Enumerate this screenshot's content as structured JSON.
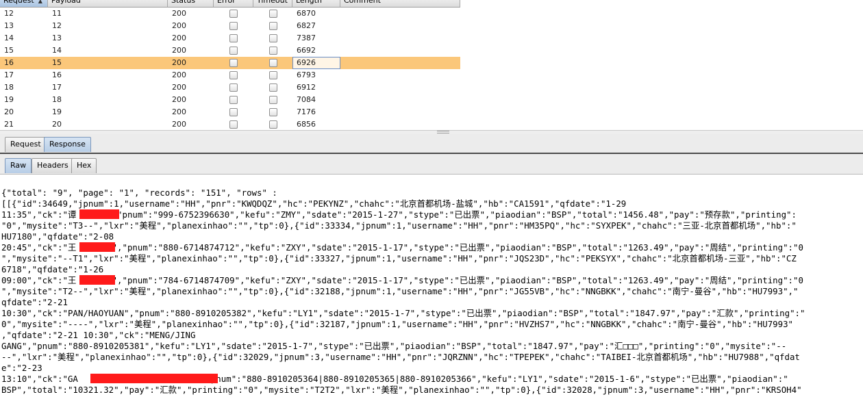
{
  "table": {
    "columns": [
      "Request",
      "Payload",
      "Status",
      "Error",
      "Timeout",
      "Length",
      "Comment"
    ],
    "sorted_column": "Request",
    "rows": [
      {
        "request": "12",
        "payload": "11",
        "status": "200",
        "length": "6870",
        "selected": false
      },
      {
        "request": "13",
        "payload": "12",
        "status": "200",
        "length": "6827",
        "selected": false
      },
      {
        "request": "14",
        "payload": "13",
        "status": "200",
        "length": "7387",
        "selected": false
      },
      {
        "request": "15",
        "payload": "14",
        "status": "200",
        "length": "6692",
        "selected": false
      },
      {
        "request": "16",
        "payload": "15",
        "status": "200",
        "length": "6926",
        "selected": true
      },
      {
        "request": "17",
        "payload": "16",
        "status": "200",
        "length": "6793",
        "selected": false
      },
      {
        "request": "18",
        "payload": "17",
        "status": "200",
        "length": "6912",
        "selected": false
      },
      {
        "request": "19",
        "payload": "18",
        "status": "200",
        "length": "7084",
        "selected": false
      },
      {
        "request": "20",
        "payload": "19",
        "status": "200",
        "length": "7176",
        "selected": false
      },
      {
        "request": "21",
        "payload": "20",
        "status": "200",
        "length": "6856",
        "selected": false
      }
    ]
  },
  "req_resp_tabs": [
    {
      "label": "Request",
      "active": false
    },
    {
      "label": "Response",
      "active": true
    }
  ],
  "view_tabs": [
    {
      "label": "Raw",
      "active": true
    },
    {
      "label": "Headers",
      "active": false
    },
    {
      "label": "Hex",
      "active": false
    }
  ],
  "raw_lines": [
    "{\"total\": \"9\", \"page\": \"1\", \"records\": \"151\", \"rows\" :",
    "[[{\"id\":34649,\"jpnum\":1,\"username\":\"HH\",\"pnr\":\"KWQDQZ\",\"hc\":\"PEKYNZ\",\"chahc\":\"北京首都机场-盐城\",\"hb\":\"CA1591\",\"qfdate\":\"1-29",
    "11:35\",\"ck\":\"谭      \",\"pnum\":\"999-6752396630\",\"kefu\":\"ZMY\",\"sdate\":\"2015-1-27\",\"stype\":\"已出票\",\"piaodian\":\"BSP\",\"total\":\"1456.48\",\"pay\":\"预存款\",\"printing\":",
    "\"0\",\"mysite\":\"T3--\",\"lxr\":\"美程\",\"planexinhao\":\"\",\"tp\":0},{\"id\":33334,\"jpnum\":1,\"username\":\"HH\",\"pnr\":\"HM35PQ\",\"hc\":\"SYXPEK\",\"chahc\":\"三亚-北京首都机场\",\"hb\":\"",
    "HU7180\",\"qfdate\":\"2-08",
    "20:45\",\"ck\":\"王      D\",\"pnum\":\"880-6714874712\",\"kefu\":\"ZXY\",\"sdate\":\"2015-1-17\",\"stype\":\"已出票\",\"piaodian\":\"BSP\",\"total\":\"1263.49\",\"pay\":\"周结\",\"printing\":\"0",
    "\",\"mysite\":\"--T1\",\"lxr\":\"美程\",\"planexinhao\":\"\",\"tp\":0},{\"id\":33327,\"jpnum\":1,\"username\":\"HH\",\"pnr\":\"JQS23D\",\"hc\":\"PEKSYX\",\"chahc\":\"北京首都机场-三亚\",\"hb\":\"CZ",
    "6718\",\"qfdate\":\"1-26",
    "09:00\",\"ck\":\"王      D\",\"pnum\":\"784-6714874709\",\"kefu\":\"ZXY\",\"sdate\":\"2015-1-17\",\"stype\":\"已出票\",\"piaodian\":\"BSP\",\"total\":\"1263.49\",\"pay\":\"周结\",\"printing\":\"0",
    "\",\"mysite\":\"T2--\",\"lxr\":\"美程\",\"planexinhao\":\"\",\"tp\":0},{\"id\":32188,\"jpnum\":1,\"username\":\"HH\",\"pnr\":\"JG55VB\",\"hc\":\"NNGBKK\",\"chahc\":\"南宁-曼谷\",\"hb\":\"HU7993\",\"",
    "qfdate\":\"2-21",
    "10:30\",\"ck\":\"PAN/HAOYUAN\",\"pnum\":\"880-8910205382\",\"kefu\":\"LY1\",\"sdate\":\"2015-1-7\",\"stype\":\"已出票\",\"piaodian\":\"BSP\",\"total\":\"1847.97\",\"pay\":\"汇款\",\"printing\":\"",
    "0\",\"mysite\":\"----\",\"lxr\":\"美程\",\"planexinhao\":\"\",\"tp\":0},{\"id\":32187,\"jpnum\":1,\"username\":\"HH\",\"pnr\":\"HVZHS7\",\"hc\":\"NNGBKK\",\"chahc\":\"南宁-曼谷\",\"hb\":\"HU7993\"",
    ",\"qfdate\":\"2-21 10:30\",\"ck\":\"MENG/JING",
    "GANG\",\"pnum\":\"880-8910205381\",\"kefu\":\"LY1\",\"sdate\":\"2015-1-7\",\"stype\":\"已出票\",\"piaodian\":\"BSP\",\"total\":\"1847.97\",\"pay\":\"汇□□□\",\"printing\":\"0\",\"mysite\":\"--",
    "--\",\"lxr\":\"美程\",\"planexinhao\":\"\",\"tp\":0},{\"id\":32029,\"jpnum\":3,\"username\":\"HH\",\"pnr\":\"JQRZNN\",\"hc\":\"TPEPEK\",\"chahc\":\"TAIBEI-北京首都机场\",\"hb\":\"HU7988\",\"qfdat",
    "e\":\"2-23",
    "13:10\",\"ck\":\"GA                      I\",\"pnum\":\"880-8910205364|880-8910205365|880-8910205366\",\"kefu\":\"LY1\",\"sdate\":\"2015-1-6\",\"stype\":\"已出票\",\"piaodian\":\"",
    "BSP\",\"total\":\"10321.32\",\"pay\":\"汇款\",\"printing\":\"0\",\"mysite\":\"T2T2\",\"lxr\":\"美程\",\"planexinhao\":\"\",\"tp\":0},{\"id\":32028,\"jpnum\":3,\"username\":\"HH\",\"pnr\":\"KRSOH4\""
  ],
  "colors": {
    "selected_row": "#fbc77a",
    "redaction": "#ff1a1a",
    "active_tab": "#c4d7ec"
  }
}
